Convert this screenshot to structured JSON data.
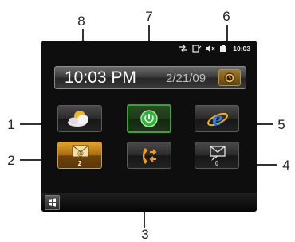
{
  "callouts": [
    "1",
    "2",
    "3",
    "4",
    "5",
    "6",
    "7",
    "8"
  ],
  "status_bar": {
    "time": "10:03",
    "icons": [
      "connectivity-icon",
      "sync-icon",
      "volume-mute-icon",
      "battery-icon"
    ]
  },
  "clock": {
    "time": "10:03 PM",
    "date": "2/21/09",
    "alarm_icon": "alarm-clock-icon"
  },
  "tiles": [
    {
      "name": "weather",
      "icon": "weather-icon"
    },
    {
      "name": "power",
      "icon": "power-icon",
      "selected": true
    },
    {
      "name": "internet-explorer",
      "icon": "internet-explorer-icon"
    },
    {
      "name": "email",
      "icon": "email-icon",
      "badge": "2"
    },
    {
      "name": "call-history",
      "icon": "call-history-icon"
    },
    {
      "name": "messages",
      "icon": "message-icon",
      "badge": "0"
    }
  ],
  "start_button_icon": "windows-start-icon",
  "colors": {
    "selected_border": "#39a33a",
    "email_tile": "#e0a22a",
    "ie_blue": "#2a7de1",
    "background": "#0e0e0e"
  }
}
